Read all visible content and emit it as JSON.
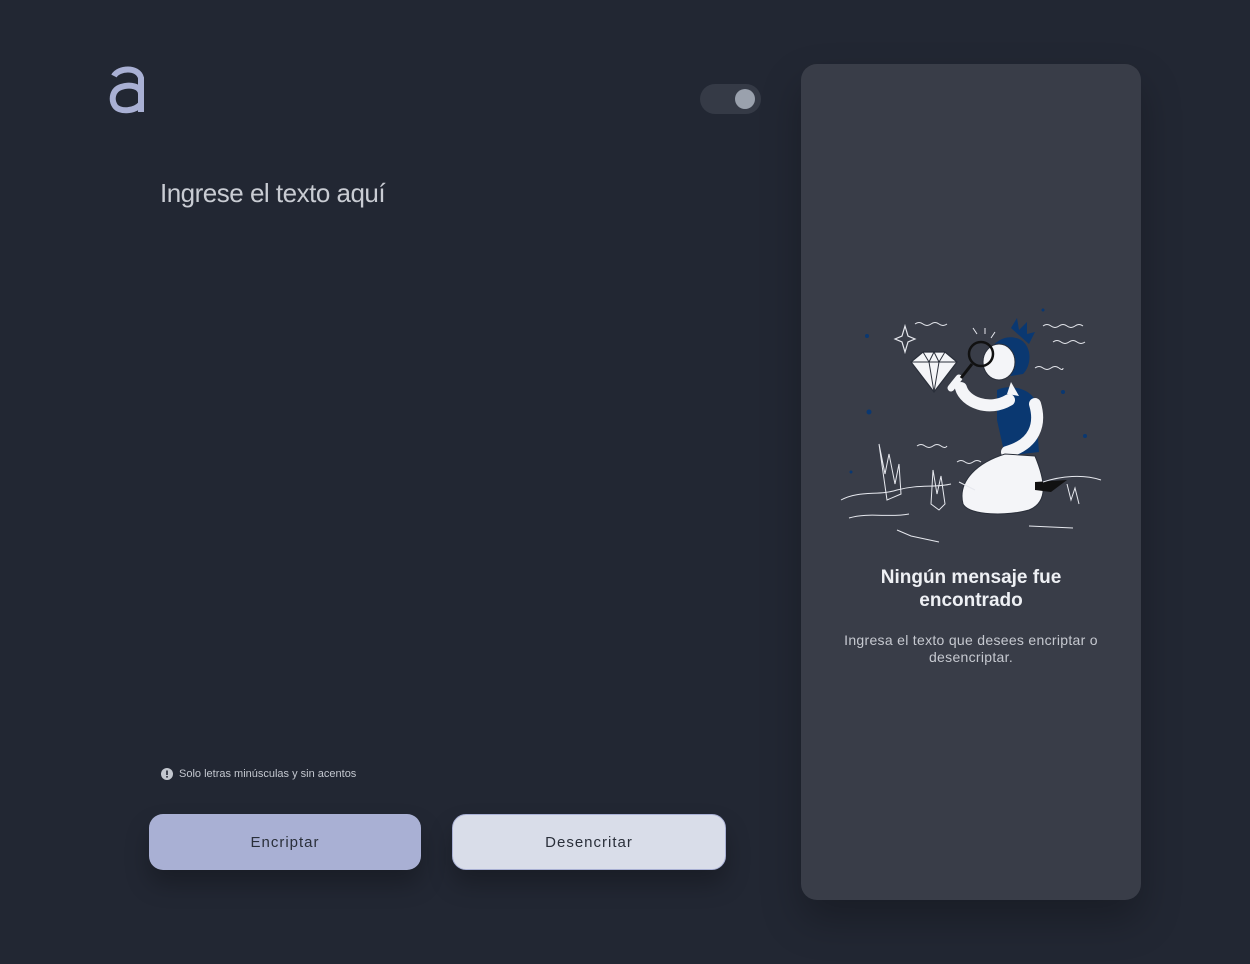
{
  "logo": {
    "icon": "alura-a-logo-icon",
    "color": "#a9b0d4"
  },
  "theme_toggle": {
    "state": "on"
  },
  "input": {
    "placeholder": "Ingrese el texto aquí",
    "value": ""
  },
  "hint": {
    "icon": "info-icon",
    "text": "Solo letras minúsculas y sin acentos"
  },
  "buttons": {
    "encrypt_label": "Encriptar",
    "decrypt_label": "Desencritar"
  },
  "output": {
    "illustration": "person-with-magnifying-glass-and-diamond",
    "title": "Ningún mensaje fue encontrado",
    "description": "Ingresa el texto que desees encriptar o desencriptar."
  },
  "colors": {
    "background": "#222733",
    "panel": "#393d48",
    "accent": "#a9b0d4",
    "secondary_button": "#d9dde9",
    "illustration_blue": "#0a3871"
  }
}
